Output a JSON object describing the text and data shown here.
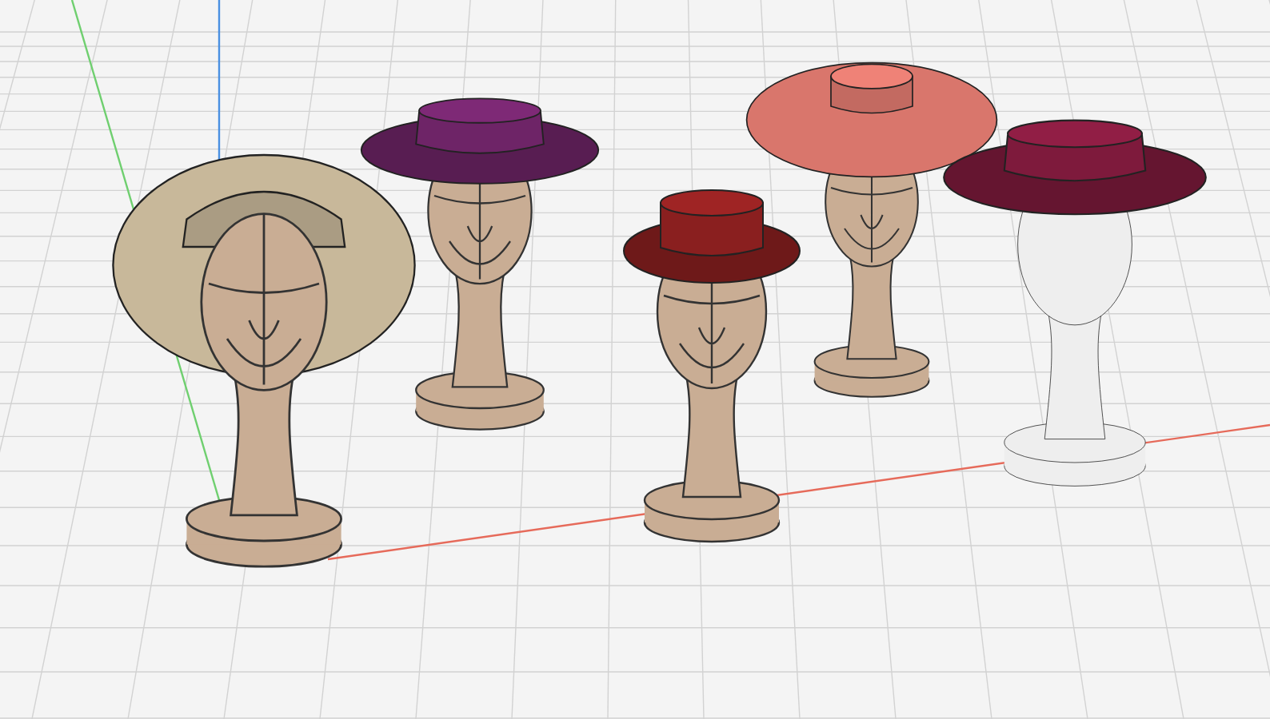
{
  "models": [
    {
      "hat": {
        "kind": "sun-hat",
        "color": "#c8b89a"
      },
      "mannequin": {
        "kind": "wire"
      }
    },
    {
      "hat": {
        "kind": "wide-brim",
        "color": "#6e2467"
      },
      "mannequin": {
        "kind": "wire"
      }
    },
    {
      "hat": {
        "kind": "boater",
        "color": "#8a1f1f"
      },
      "mannequin": {
        "kind": "wire"
      }
    },
    {
      "hat": {
        "kind": "cartwheel",
        "color": "#d9766c"
      },
      "mannequin": {
        "kind": "wire"
      }
    },
    {
      "hat": {
        "kind": "wide-brim",
        "color": "#7e1a3c"
      },
      "mannequin": {
        "kind": "plain"
      }
    }
  ]
}
